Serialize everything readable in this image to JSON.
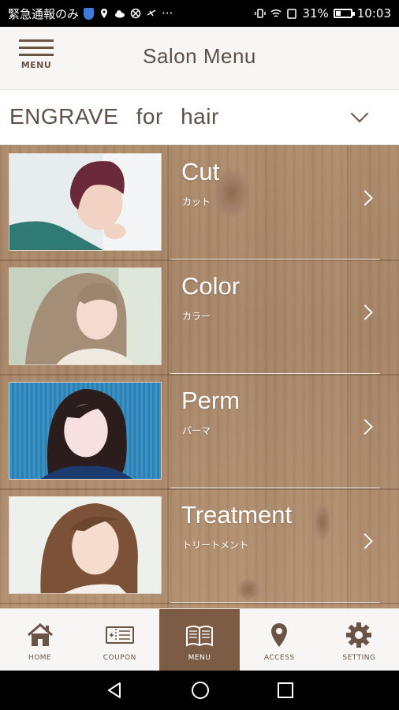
{
  "status_bar": {
    "carrier_text": "緊急通報のみ",
    "battery_percent": "31%",
    "time": "10:03"
  },
  "header": {
    "menu_label": "MENU",
    "title": "Salon Menu"
  },
  "salon_selector": {
    "value": "ENGRAVE for hair"
  },
  "menu_items": [
    {
      "title": "Cut",
      "subtitle": "カット"
    },
    {
      "title": "Color",
      "subtitle": "カラー"
    },
    {
      "title": "Perm",
      "subtitle": "パーマ"
    },
    {
      "title": "Treatment",
      "subtitle": "トリートメント"
    }
  ],
  "tabs": [
    {
      "label": "HOME",
      "icon": "home-icon",
      "active": false
    },
    {
      "label": "COUPON",
      "icon": "coupon-icon",
      "active": false
    },
    {
      "label": "MENU",
      "icon": "book-icon",
      "active": true
    },
    {
      "label": "ACCESS",
      "icon": "map-pin-icon",
      "active": false
    },
    {
      "label": "SETTING",
      "icon": "gear-icon",
      "active": false
    }
  ],
  "colors": {
    "brand_brown": "#7d5c46",
    "text_brown": "#5e5048",
    "wood": "#b08e6e"
  }
}
